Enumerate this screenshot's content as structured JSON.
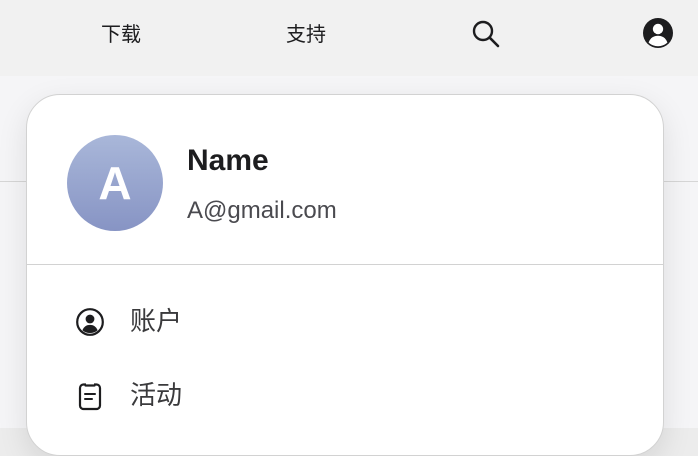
{
  "nav": {
    "download_label": "下载",
    "support_label": "支持",
    "search_icon": "search-icon",
    "account_icon": "account-circle-icon"
  },
  "user": {
    "avatar_letter": "A",
    "name": "Name",
    "email": "A@gmail.com"
  },
  "menu": {
    "items": [
      {
        "label": "账户",
        "icon": "person-circle-icon"
      },
      {
        "label": "活动",
        "icon": "clipboard-icon"
      }
    ]
  },
  "colors": {
    "nav_background": "#f1f1f1",
    "card_background": "#ffffff",
    "avatar_gradient_top": "#a9b7d9",
    "avatar_gradient_bottom": "#8794c4",
    "text_primary": "#1d1d1f",
    "text_secondary": "#4a4a4f"
  }
}
